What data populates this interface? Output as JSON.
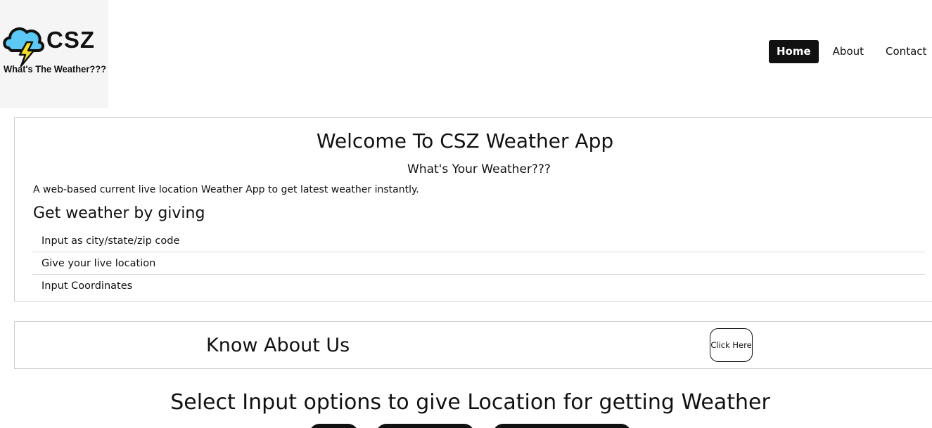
{
  "header": {
    "logo": {
      "brand": "CSZ",
      "tagline": "What's The Weather???",
      "icon": "cloud-lightning-icon",
      "colors": {
        "cloud": "#5bc8f5",
        "bolt": "#f2e02b",
        "outline": "#111111"
      }
    },
    "nav": [
      {
        "label": "Home",
        "active": true
      },
      {
        "label": "About",
        "active": false
      },
      {
        "label": "Contact",
        "active": false
      }
    ]
  },
  "welcome": {
    "title": "Welcome To CSZ Weather App",
    "subtitle": "What's Your Weather???",
    "description": "A web-based current live location Weather App to get latest weather instantly.",
    "options_heading": "Get weather by giving",
    "options": [
      "Input as city/state/zip code",
      "Give your live location",
      "Input Coordinates"
    ]
  },
  "about": {
    "title": "Know About Us",
    "button_label": "Click Here"
  },
  "select_section": {
    "heading": "Select Input options to give Location for getting Weather"
  },
  "colors": {
    "accent": "#111111",
    "border": "#cfcfcf",
    "background": "#ffffff"
  }
}
